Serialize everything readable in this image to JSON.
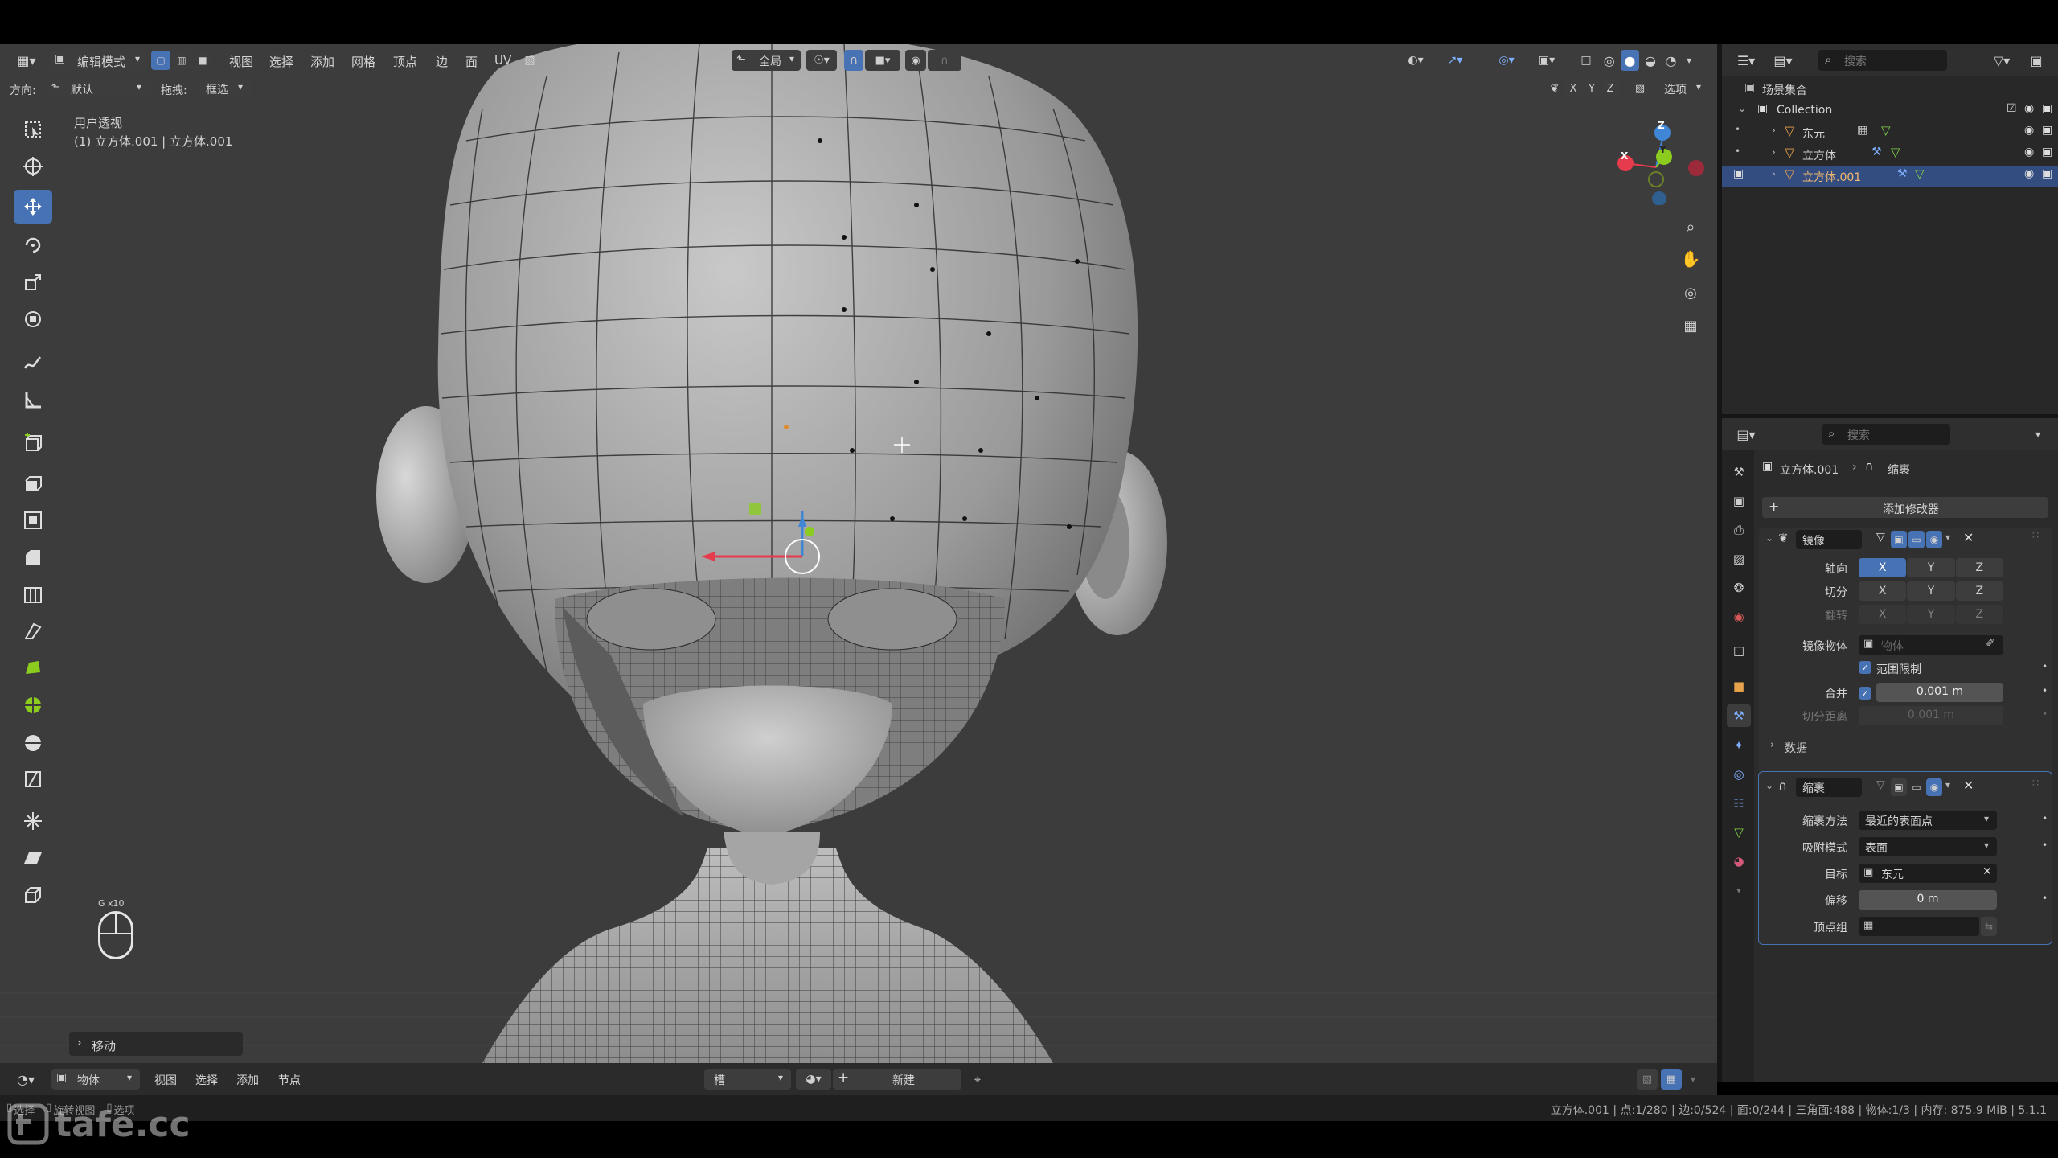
{
  "header3d": {
    "mode": "编辑模式",
    "menus": [
      "视图",
      "选择",
      "添加",
      "网格",
      "顶点",
      "边",
      "面",
      "UV"
    ],
    "transform_orientation": "全局",
    "axes": [
      "X",
      "Y",
      "Z"
    ],
    "options": "选项"
  },
  "toolsettings": {
    "orient_label": "方向:",
    "orient_value": "默认",
    "drag_label": "拖拽:",
    "drag_value": "框选"
  },
  "viewport": {
    "view_name": "用户透视",
    "object_info": "(1) 立方体.001 | 立方体.001",
    "gizmo": {
      "x": "X",
      "y": "Y",
      "z": "Z"
    },
    "key_hint": "G x10",
    "last_op": "移动"
  },
  "outliner": {
    "search_placeholder": "搜索",
    "scene_collection": "场景集合",
    "collection": "Collection",
    "objects": [
      {
        "name": "东元"
      },
      {
        "name": "立方体"
      },
      {
        "name": "立方体.001"
      }
    ]
  },
  "properties": {
    "search_placeholder": "搜索",
    "breadcrumb_object": "立方体.001",
    "breadcrumb_modifier": "缩裹",
    "add_modifier": "添加修改器",
    "mirror": {
      "name": "镜像",
      "axis_label": "轴向",
      "bisect_label": "切分",
      "flip_label": "翻转",
      "x": "X",
      "y": "Y",
      "z": "Z",
      "mirror_object_label": "镜像物体",
      "mirror_object_placeholder": "物体",
      "clipping_label": "范围限制",
      "merge_label": "合并",
      "merge_value": "0.001 m",
      "bisect_distance_label": "切分距离",
      "bisect_distance_value": "0.001 m",
      "data_label": "数据"
    },
    "shrinkwrap": {
      "name": "缩裹",
      "method_label": "缩裹方法",
      "method_value": "最近的表面点",
      "snap_label": "吸附模式",
      "snap_value": "表面",
      "target_label": "目标",
      "target_value": "东元",
      "offset_label": "偏移",
      "offset_value": "0 m",
      "vgroup_label": "顶点组"
    }
  },
  "bottom_editor": {
    "mode": "物体",
    "menus": [
      "视图",
      "选择",
      "添加",
      "节点"
    ],
    "slot": "槽",
    "new_button": "新建"
  },
  "statusbar": {
    "hints": [
      "选择",
      "旋转视图",
      "选项"
    ],
    "stats": "立方体.001 | 点:1/280 | 边:0/524 | 面:0/244 | 三角面:488 | 物体:1/3 | 内存: 875.9 MiB | 5.1.1"
  },
  "watermark": "tafe.cc",
  "colors": {
    "accent": "#4772b3",
    "axis_x": "#e63a4d",
    "axis_y": "#8bcc1f",
    "axis_z": "#3f86d6",
    "viewport_bg": "#3d3d3d"
  }
}
